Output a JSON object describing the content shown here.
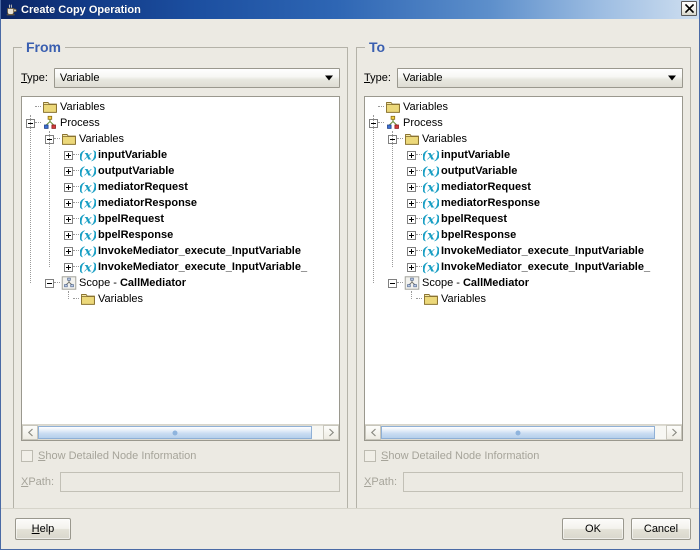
{
  "window": {
    "title": "Create Copy Operation",
    "icon": "java-coffee-cup-icon",
    "close_label": "X",
    "titlebar_color": "#0a2463",
    "accent_color": "#3a5fb0"
  },
  "panels": [
    {
      "id": "from",
      "title": "From",
      "type_label": "Type:",
      "type_mnemonic": "T",
      "type_value": "Variable",
      "checkbox": {
        "label": "Show Detailed Node Information",
        "mnemonic": "S",
        "checked": false,
        "disabled": true
      },
      "xpath": {
        "label": "XPath:",
        "mnemonic": "X",
        "value": "",
        "placeholder": "",
        "disabled": true
      },
      "tree": [
        {
          "depth": 0,
          "toggle": "none",
          "icon": "folder-icon",
          "label": "Variables",
          "bold": false
        },
        {
          "depth": 0,
          "toggle": "expanded",
          "icon": "process-icon",
          "label": "Process",
          "bold": false
        },
        {
          "depth": 1,
          "toggle": "expanded",
          "icon": "folder-icon",
          "label": "Variables",
          "bold": false
        },
        {
          "depth": 2,
          "toggle": "collapsed",
          "icon": "variable-icon",
          "label": "inputVariable",
          "bold": true
        },
        {
          "depth": 2,
          "toggle": "collapsed",
          "icon": "variable-icon",
          "label": "outputVariable",
          "bold": true
        },
        {
          "depth": 2,
          "toggle": "collapsed",
          "icon": "variable-icon",
          "label": "mediatorRequest",
          "bold": true
        },
        {
          "depth": 2,
          "toggle": "collapsed",
          "icon": "variable-icon",
          "label": "mediatorResponse",
          "bold": true
        },
        {
          "depth": 2,
          "toggle": "collapsed",
          "icon": "variable-icon",
          "label": "bpelRequest",
          "bold": true
        },
        {
          "depth": 2,
          "toggle": "collapsed",
          "icon": "variable-icon",
          "label": "bpelResponse",
          "bold": true
        },
        {
          "depth": 2,
          "toggle": "collapsed",
          "icon": "variable-icon",
          "label": "InvokeMediator_execute_InputVariable",
          "bold": true
        },
        {
          "depth": 2,
          "toggle": "collapsed",
          "icon": "variable-icon",
          "label": "InvokeMediator_execute_InputVariable_",
          "bold": true
        },
        {
          "depth": 1,
          "toggle": "expanded",
          "icon": "scope-icon",
          "label": "Scope - ",
          "label_bold_suffix": "CallMediator",
          "bold": false
        },
        {
          "depth": 2,
          "toggle": "none",
          "icon": "folder-icon",
          "label": "Variables",
          "bold": false
        }
      ]
    },
    {
      "id": "to",
      "title": "To",
      "type_label": "Type:",
      "type_mnemonic": "T",
      "type_value": "Variable",
      "checkbox": {
        "label": "Show Detailed Node Information",
        "mnemonic": "S",
        "checked": false,
        "disabled": true
      },
      "xpath": {
        "label": "XPath:",
        "mnemonic": "X",
        "value": "",
        "placeholder": "",
        "disabled": true
      },
      "tree": [
        {
          "depth": 0,
          "toggle": "none",
          "icon": "folder-icon",
          "label": "Variables",
          "bold": false
        },
        {
          "depth": 0,
          "toggle": "expanded",
          "icon": "process-icon",
          "label": "Process",
          "bold": false
        },
        {
          "depth": 1,
          "toggle": "expanded",
          "icon": "folder-icon",
          "label": "Variables",
          "bold": false
        },
        {
          "depth": 2,
          "toggle": "collapsed",
          "icon": "variable-icon",
          "label": "inputVariable",
          "bold": true
        },
        {
          "depth": 2,
          "toggle": "collapsed",
          "icon": "variable-icon",
          "label": "outputVariable",
          "bold": true
        },
        {
          "depth": 2,
          "toggle": "collapsed",
          "icon": "variable-icon",
          "label": "mediatorRequest",
          "bold": true
        },
        {
          "depth": 2,
          "toggle": "collapsed",
          "icon": "variable-icon",
          "label": "mediatorResponse",
          "bold": true
        },
        {
          "depth": 2,
          "toggle": "collapsed",
          "icon": "variable-icon",
          "label": "bpelRequest",
          "bold": true
        },
        {
          "depth": 2,
          "toggle": "collapsed",
          "icon": "variable-icon",
          "label": "bpelResponse",
          "bold": true
        },
        {
          "depth": 2,
          "toggle": "collapsed",
          "icon": "variable-icon",
          "label": "InvokeMediator_execute_InputVariable",
          "bold": true
        },
        {
          "depth": 2,
          "toggle": "collapsed",
          "icon": "variable-icon",
          "label": "InvokeMediator_execute_InputVariable_",
          "bold": true
        },
        {
          "depth": 1,
          "toggle": "expanded",
          "icon": "scope-icon",
          "label": "Scope - ",
          "label_bold_suffix": "CallMediator",
          "bold": false
        },
        {
          "depth": 2,
          "toggle": "none",
          "icon": "folder-icon",
          "label": "Variables",
          "bold": false
        }
      ]
    }
  ],
  "footer": {
    "help_label": "Help",
    "help_mnemonic": "H",
    "ok_label": "OK",
    "cancel_label": "Cancel"
  }
}
